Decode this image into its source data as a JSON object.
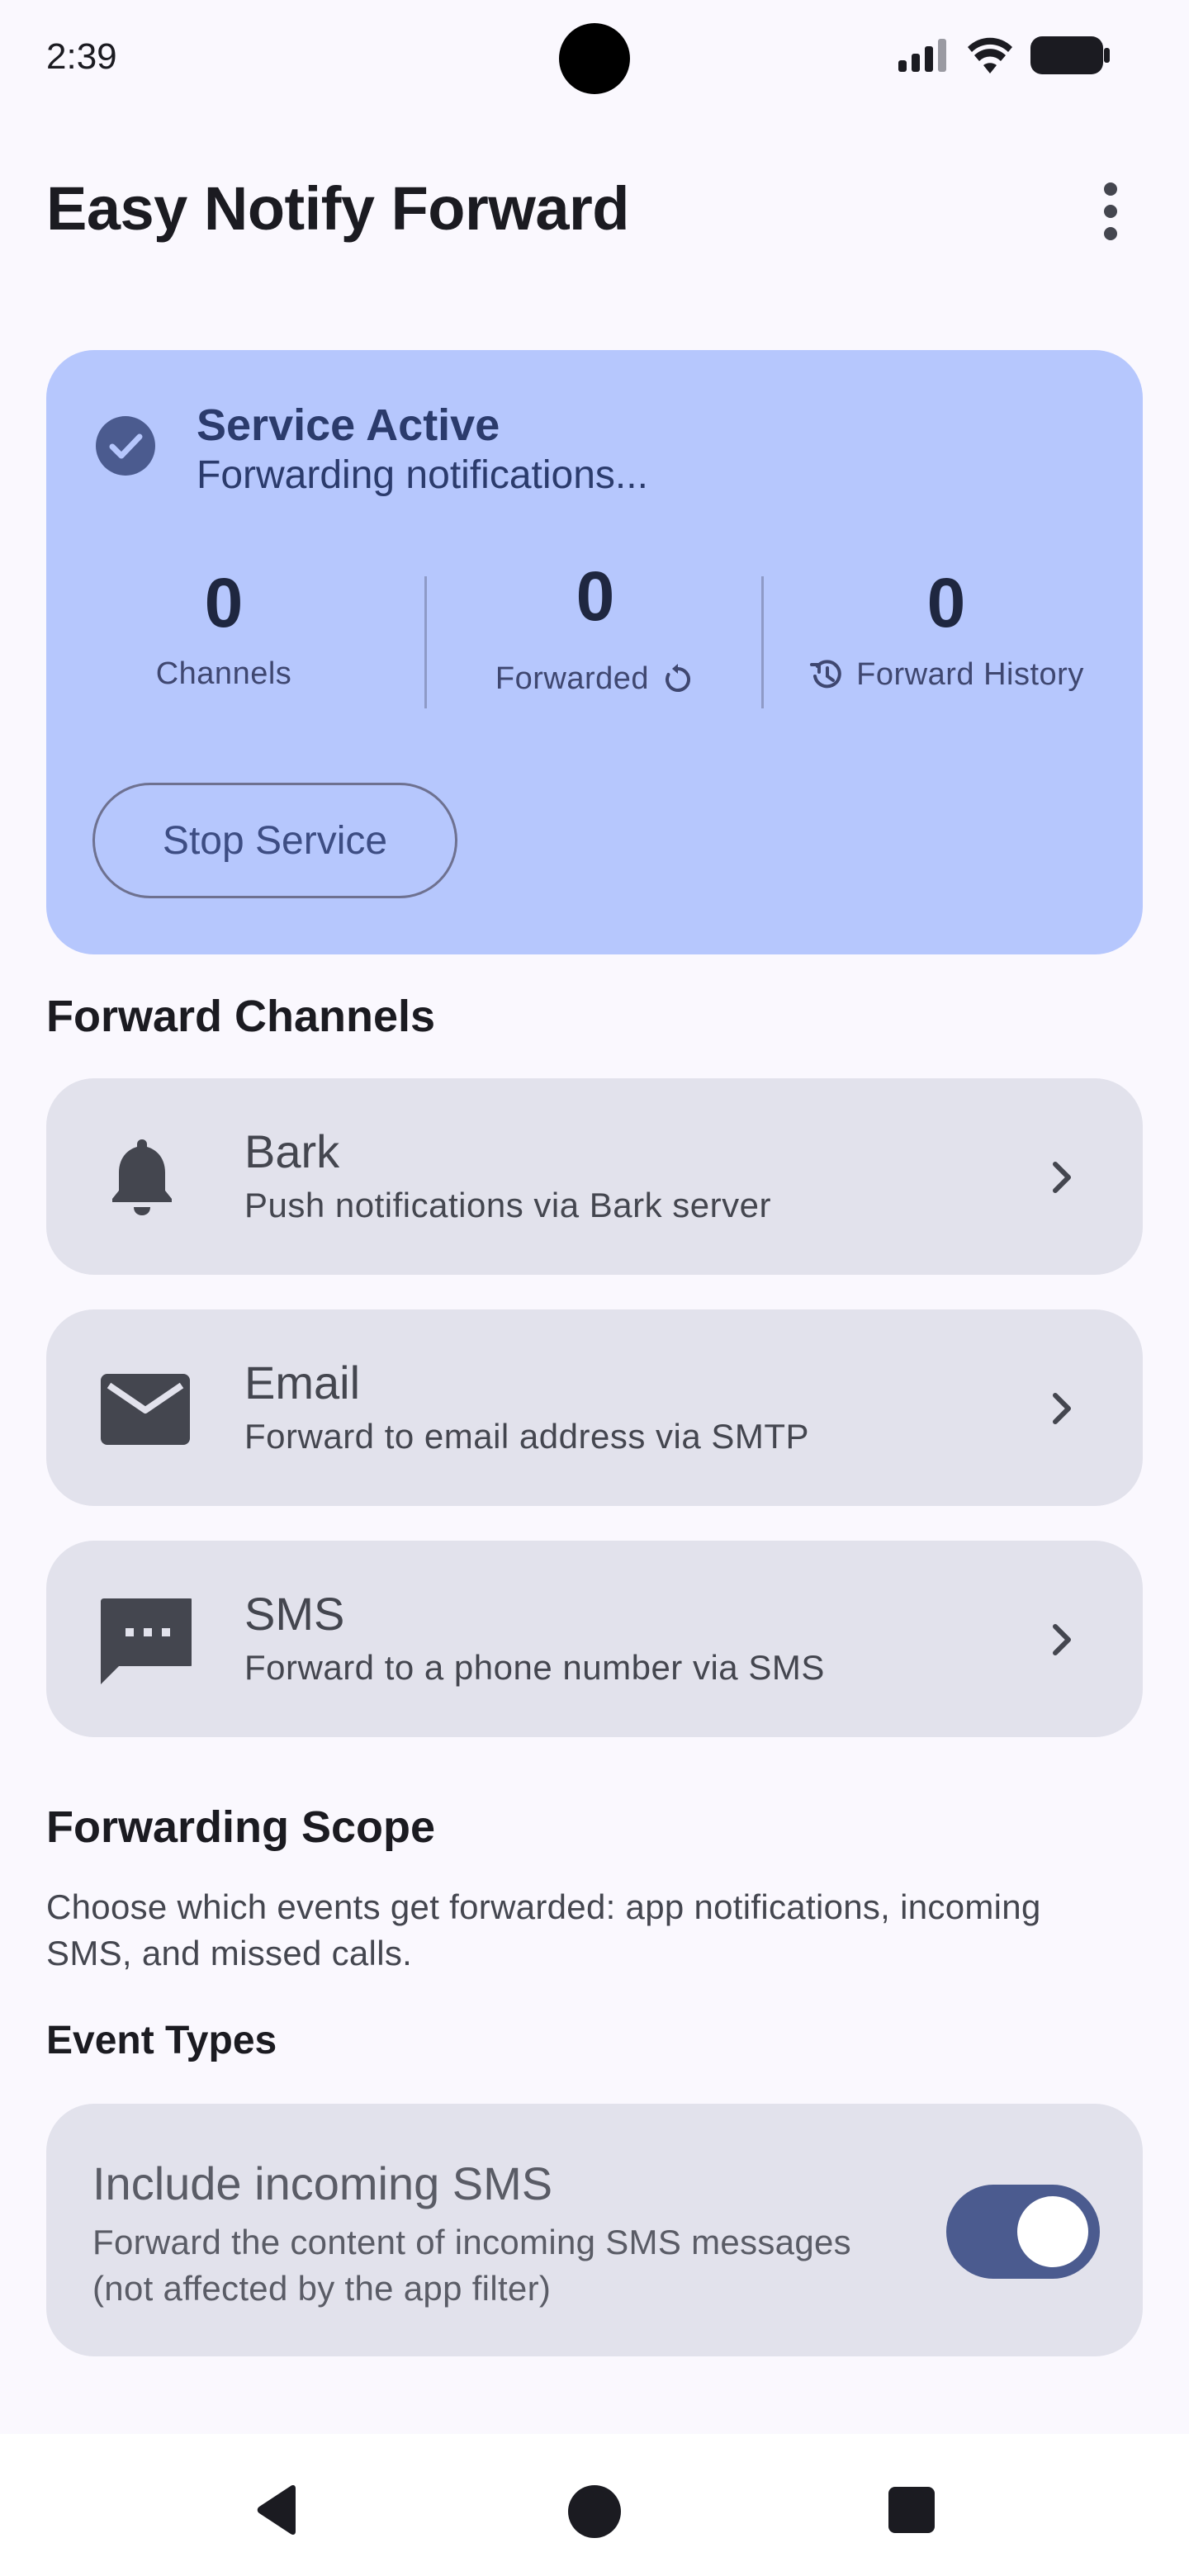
{
  "status_bar": {
    "time": "2:39"
  },
  "app_bar": {
    "title": "Easy Notify Forward",
    "menu_icon": "more-vert-icon"
  },
  "service": {
    "title": "Service Active",
    "subtitle": "Forwarding notifications...",
    "stats": {
      "channels": {
        "value": "0",
        "label": "Channels"
      },
      "forwarded": {
        "value": "0",
        "label": "Forwarded"
      },
      "history": {
        "value": "0",
        "label": "Forward History"
      }
    },
    "stop_label": "Stop Service",
    "colors": {
      "card": "#b6c7fd",
      "text": "#2b3b6c"
    }
  },
  "channels_section": {
    "title": "Forward Channels",
    "items": [
      {
        "name": "Bark",
        "desc": "Push notifications via Bark server",
        "icon": "bell-icon"
      },
      {
        "name": "Email",
        "desc": "Forward to email address via SMTP",
        "icon": "mail-icon"
      },
      {
        "name": "SMS",
        "desc": "Forward to a phone number via SMS",
        "icon": "sms-icon"
      }
    ]
  },
  "scope_section": {
    "title": "Forwarding Scope",
    "description": "Choose which events get forwarded: app notifications, incoming SMS, and missed calls.",
    "event_types_label": "Event Types",
    "toggle": {
      "title": "Include incoming SMS",
      "description": "Forward the content of incoming SMS messages (not affected by the app filter)",
      "enabled": true
    }
  }
}
